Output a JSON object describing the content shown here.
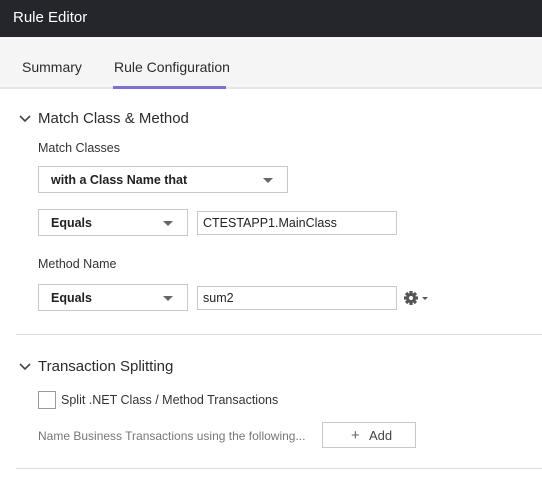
{
  "window": {
    "title": "Rule Editor"
  },
  "tabs": [
    {
      "label": "Summary",
      "active": false
    },
    {
      "label": "Rule Configuration",
      "active": true
    }
  ],
  "colors": {
    "tab_active_underline": "#7b6fd8",
    "titlebar": "#24262b"
  },
  "match_section": {
    "title": "Match Class & Method",
    "match_classes_label": "Match Classes",
    "class_select": "with a Class Name that",
    "class_operator": "Equals",
    "class_value": "CTESTAPP1.MainClass",
    "method_name_label": "Method Name",
    "method_operator": "Equals",
    "method_value": "sum2",
    "settings_icon": "gear-icon"
  },
  "splitting_section": {
    "title": "Transaction Splitting",
    "checkbox_label": "Split .NET Class / Method Transactions",
    "checkbox_checked": false,
    "naming_label": "Name Business Transactions using the following...",
    "add_label": "Add"
  }
}
